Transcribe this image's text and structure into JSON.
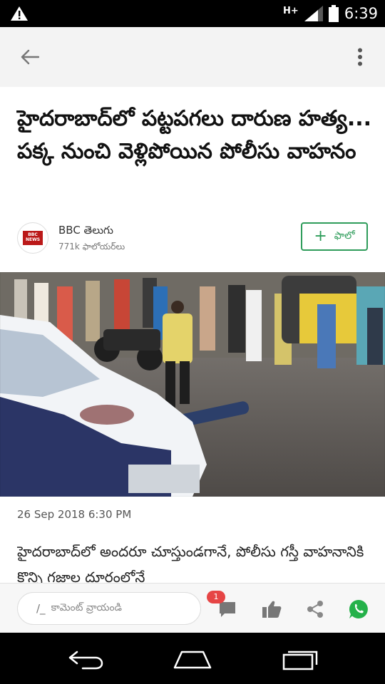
{
  "status_bar": {
    "network": "H+",
    "time": "6:39"
  },
  "headline": "హైదరాబాద్‌లో పట్టపగలు దారుణ హత్య... పక్క నుంచి వెళ్లిపోయిన పోలీసు వాహనం",
  "source": {
    "name": "BBC తెలుగు",
    "followers": "771k ఫాలోయర్‌లు",
    "logo_text": "BBC NEWS",
    "follow_plus": "+",
    "follow_label": "ఫాలో"
  },
  "article": {
    "date": "26 Sep 2018 6:30 PM",
    "body": "హైదరాబాద్‌లో అందరూ చూస్తుండగానే, పోలీసు గస్తీ వాహనానికి కొన్ని గజాల దూరంలోనే"
  },
  "actions": {
    "comment_placeholder": "కామెంట్ వ్రాయండి",
    "comment_count": "1"
  },
  "icons": {
    "warning": "warning-icon",
    "back": "arrow-back-icon",
    "more": "more-vert-icon",
    "comment": "comment-icon",
    "like": "thumb-up-icon",
    "share": "share-icon",
    "whatsapp": "whatsapp-icon"
  },
  "colors": {
    "accent_green": "#2e9c5a",
    "badge_red": "#e64545",
    "whatsapp_green": "#25b14a"
  }
}
